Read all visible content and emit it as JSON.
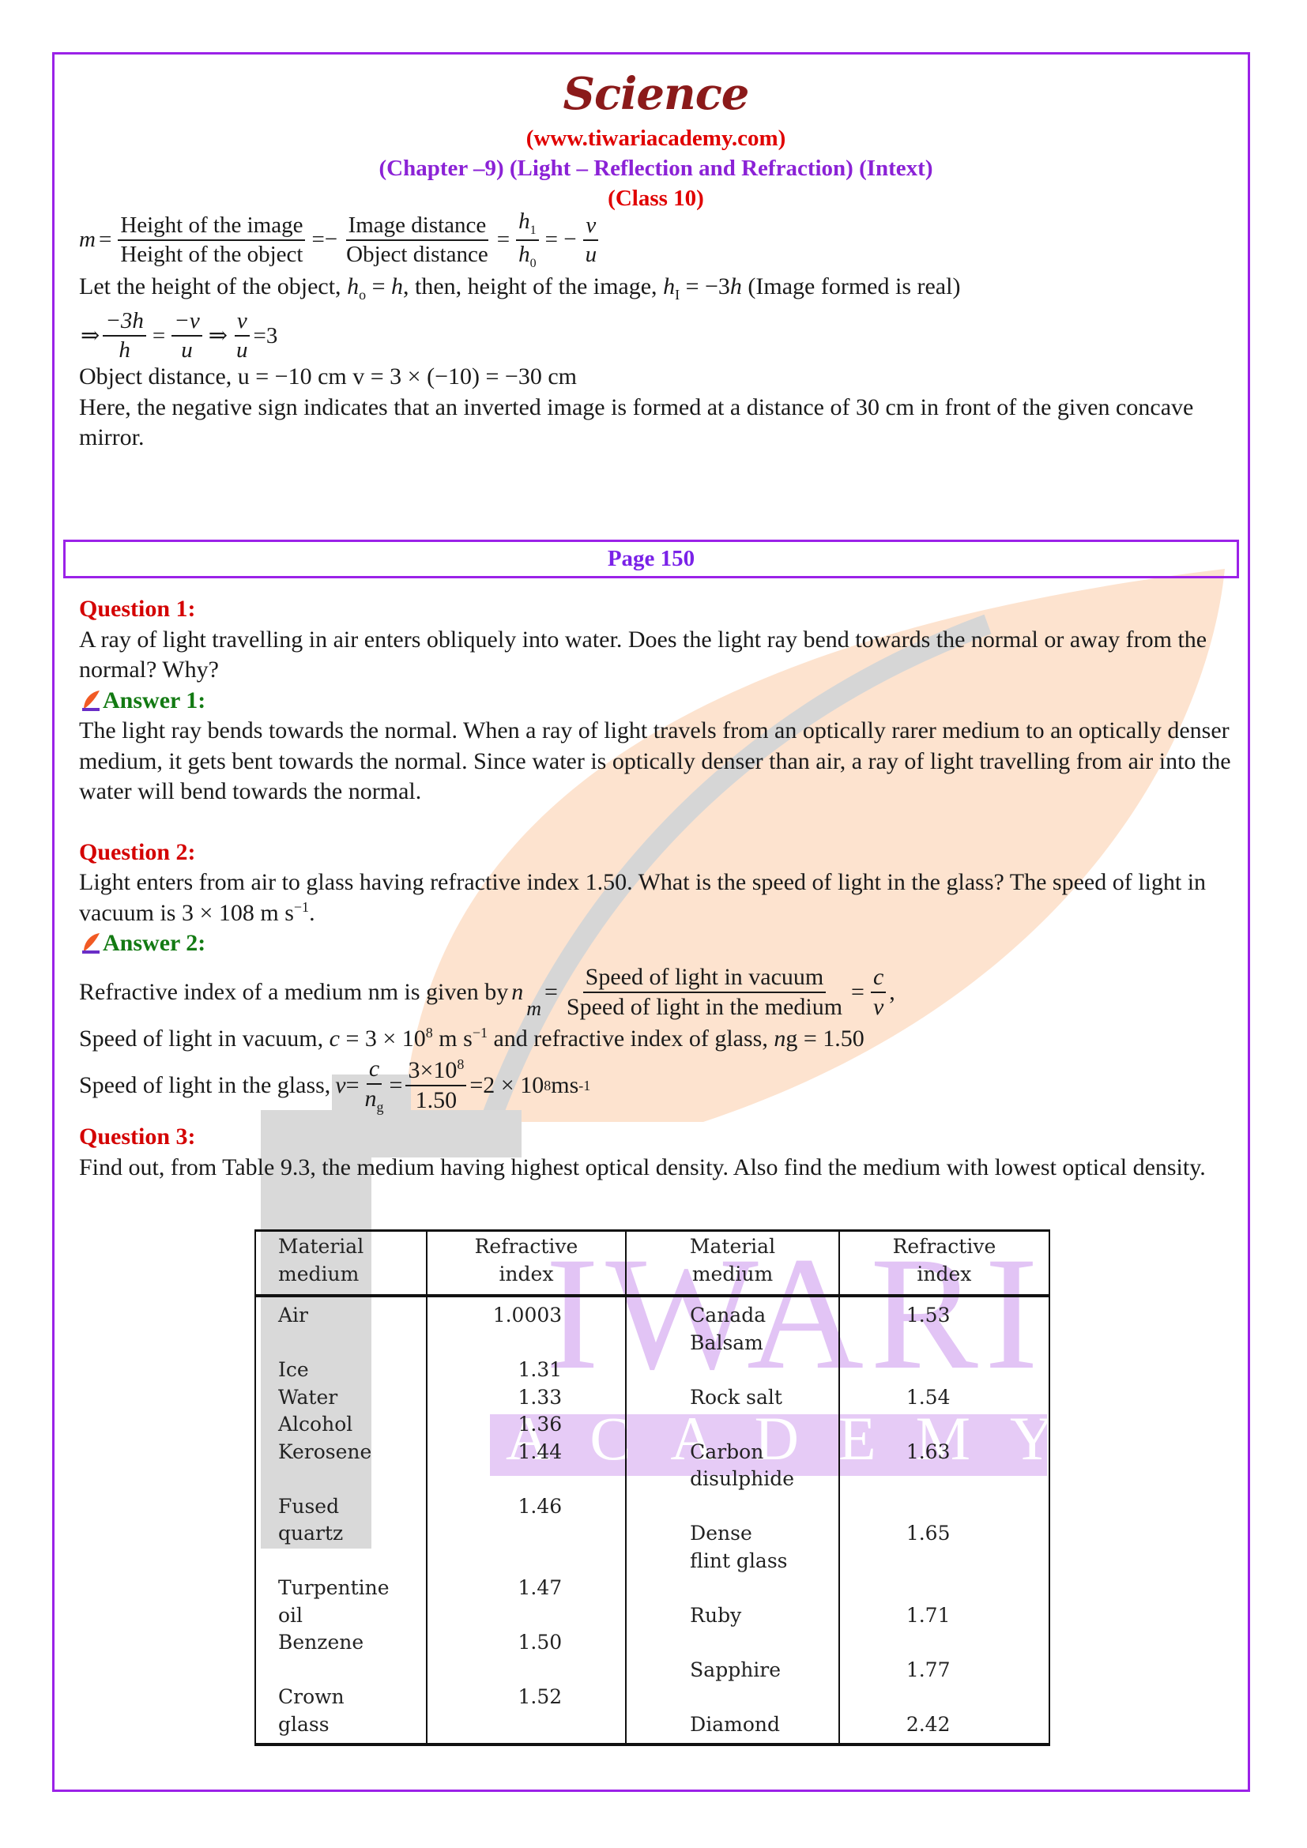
{
  "header": {
    "title": "Science",
    "site": "(www.tiwariacademy.com)",
    "chapter": "(Chapter –9) (Light – Reflection and Refraction) (Intext)",
    "class": "(Class 10)"
  },
  "intro": {
    "mag_eq": {
      "lhs": "m",
      "f1_num": "Height of the image",
      "f1_den": "Height of the object",
      "f2_num": "Image distance",
      "f2_den": "Object distance",
      "f3_num": "h",
      "f3_num_sub": "1",
      "f3_den": "h",
      "f3_den_sub": "0",
      "f4_num": "v",
      "f4_den": "u",
      "eq": "=",
      "eq_neg": "=−",
      "eq_neg2": "= −"
    },
    "let_line": {
      "p1": "Let the height of the object, ",
      "h0": "h",
      "h0_sub": "o",
      "p2": " = ",
      "h": "h",
      "p3": ", then, height of the image, ",
      "h1": "h",
      "h1_sub": "I",
      "p4": " = −3",
      "h2": "h",
      "p5": " (Image formed is real)"
    },
    "ratio_eq": {
      "arrow": "⇒",
      "f1_num": "−3h",
      "f1_den": "h",
      "f2_num": "−v",
      "f2_den": "u",
      "f3_num": "v",
      "f3_den": "u",
      "eq": "=",
      "result": "=3"
    },
    "object_distance": "Object distance, u = −10 cm v = 3 × (−10) = −30 cm",
    "conclusion": "Here, the negative sign indicates that an inverted image is formed at a distance of 30 cm in front of the given concave mirror."
  },
  "page_label": "Page 150",
  "questions": [
    {
      "label": "Question 1:",
      "text": "A ray of light travelling in air enters obliquely into water. Does the light ray bend towards the normal or away from the normal? Why?",
      "answer_label": "Answer 1:",
      "answer": "The light ray bends towards the normal. When a ray of light travels from an optically rarer medium to an optically denser medium, it gets bent towards the normal. Since water is optically denser than air, a ray of light travelling from air into the water will bend towards the normal."
    },
    {
      "label": "Question 2:",
      "text": "Light enters from air to glass having refractive index 1.50. What is the speed of light in the glass? The speed of light in vacuum is 3 × 108 m s",
      "text_sup": "−1",
      "text_end": ".",
      "answer_label": "Answer 2:",
      "answer_lines": {
        "l1_prefix": "Refractive index of a medium nm is given by",
        "l1_n": "n",
        "l1_n_sub": "m",
        "l1_eq": "=",
        "l1_num": "Speed of light in vacuum",
        "l1_den": "Speed of light in the medium",
        "l1_eq2": "=",
        "l1_c": "c",
        "l1_v": "v",
        "l1_comma": ",",
        "l2_a": "Speed of light in vacuum, ",
        "l2_c": "c",
        "l2_b": " = 3 × 10",
        "l2_sup": "8",
        "l2_c2": " m s",
        "l2_sup2": "−1",
        "l2_d": " and refractive index of glass, ",
        "l2_n": "n",
        "l2_e": "g = 1.50",
        "l3_prefix": "Speed of light in the glass,",
        "l3_v": "v",
        "l3_eq": "=",
        "l3_num1": "c",
        "l3_den1": "n",
        "l3_den1_sub": "g",
        "l3_eq2": "=",
        "l3_num2": "3×10",
        "l3_num2_sup": "8",
        "l3_den2": "1.50",
        "l3_result": "=2 × 10",
        "l3_result_sup": "8",
        "l3_unit": "ms",
        "l3_unit_sup": "-1"
      }
    },
    {
      "label": "Question 3:",
      "text": "Find out, from Table 9.3, the medium having highest optical density. Also find the medium with lowest optical density."
    }
  ],
  "table": {
    "headers": [
      [
        "Material",
        "medium"
      ],
      [
        "Refractive",
        "index"
      ],
      [
        "Material",
        "medium"
      ],
      [
        "Refractive",
        "index"
      ]
    ],
    "col1_lines": [
      "Air",
      "",
      "Ice",
      "Water",
      "Alcohol",
      "Kerosene",
      "",
      "Fused",
      "quartz",
      "",
      "Turpentine",
      "oil",
      "Benzene",
      "",
      "Crown",
      "glass"
    ],
    "col2_lines": [
      "1.0003",
      "",
      "1.31",
      "1.33",
      "1.36",
      "1.44",
      "",
      "1.46",
      "",
      "",
      "1.47",
      "",
      "1.50",
      "",
      "1.52",
      ""
    ],
    "col3_lines": [
      "Canada",
      "Balsam",
      "",
      "Rock salt",
      "",
      "Carbon",
      "disulphide",
      "",
      "Dense",
      "flint glass",
      "",
      "Ruby",
      "",
      "Sapphire",
      "",
      "Diamond"
    ],
    "col4_lines": [
      "1.53",
      "",
      "",
      "1.54",
      "",
      "1.63",
      "",
      "",
      "1.65",
      "",
      "",
      "1.71",
      "",
      "1.77",
      "",
      "2.42"
    ],
    "rows": [
      {
        "medium": "Air",
        "index": "1.0003"
      },
      {
        "medium": "Ice",
        "index": "1.31"
      },
      {
        "medium": "Water",
        "index": "1.33"
      },
      {
        "medium": "Alcohol",
        "index": "1.36"
      },
      {
        "medium": "Kerosene",
        "index": "1.44"
      },
      {
        "medium": "Fused quartz",
        "index": "1.46"
      },
      {
        "medium": "Turpentine oil",
        "index": "1.47"
      },
      {
        "medium": "Benzene",
        "index": "1.50"
      },
      {
        "medium": "Crown glass",
        "index": "1.52"
      },
      {
        "medium": "Canada Balsam",
        "index": "1.53"
      },
      {
        "medium": "Rock salt",
        "index": "1.54"
      },
      {
        "medium": "Carbon disulphide",
        "index": "1.63"
      },
      {
        "medium": "Dense flint glass",
        "index": "1.65"
      },
      {
        "medium": "Ruby",
        "index": "1.71"
      },
      {
        "medium": "Sapphire",
        "index": "1.77"
      },
      {
        "medium": "Diamond",
        "index": "2.42"
      }
    ]
  },
  "watermark": {
    "word1": "IWARI",
    "word2": "ACADEMY",
    "colors": {
      "leaf": "#fde3cf",
      "t": "#d9d9d9",
      "text": "#e2c4f5"
    }
  },
  "colors": {
    "border": "#9b22e8",
    "title": "#8b1a1a",
    "red": "#d40000",
    "purple": "#8b22d6",
    "green": "#137a13"
  }
}
